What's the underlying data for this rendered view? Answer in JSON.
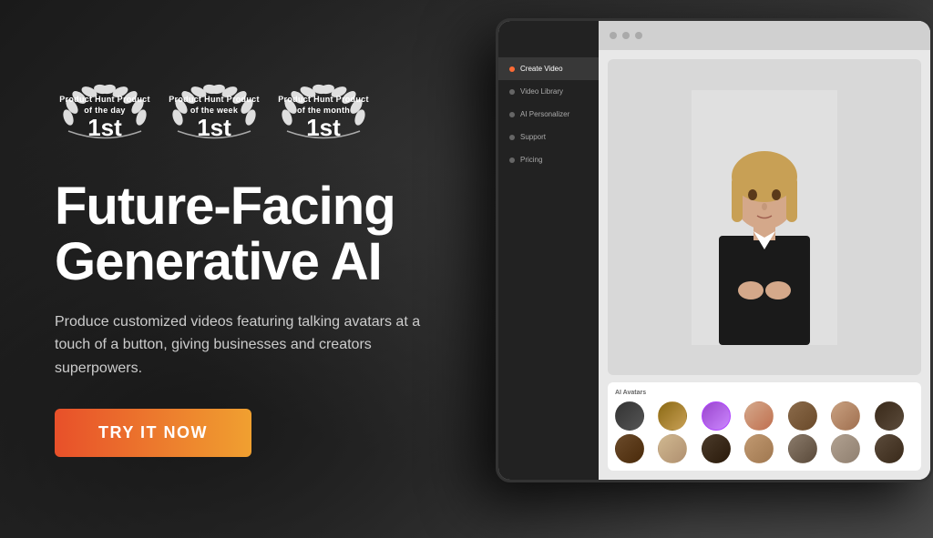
{
  "page": {
    "background_color": "#1a1a1a"
  },
  "badges": [
    {
      "title": "Product Hunt\nProduct of the day",
      "rank": "1st"
    },
    {
      "title": "Product Hunt\nProduct of the week",
      "rank": "1st"
    },
    {
      "title": "Product Hunt\nProduct of the month",
      "rank": "1st"
    }
  ],
  "hero": {
    "headline_line1": "Future-Facing",
    "headline_line2": "Generative AI",
    "subheadline": "Produce customized videos featuring talking avatars at a touch of a button, giving businesses and creators superpowers.",
    "cta_label": "TRY IT NOW"
  },
  "app_ui": {
    "sidebar_items": [
      {
        "label": "Create Video",
        "active": true
      },
      {
        "label": "Video Library",
        "active": false
      },
      {
        "label": "AI Personalizer",
        "active": false
      },
      {
        "label": "Support",
        "active": false
      },
      {
        "label": "Pricing",
        "active": false
      }
    ],
    "avatar_section_label": "AI Avatars",
    "avatar_count": 14
  },
  "colors": {
    "cta_gradient_start": "#e8502a",
    "cta_gradient_end": "#f0a030",
    "accent_purple": "#b044ff"
  }
}
